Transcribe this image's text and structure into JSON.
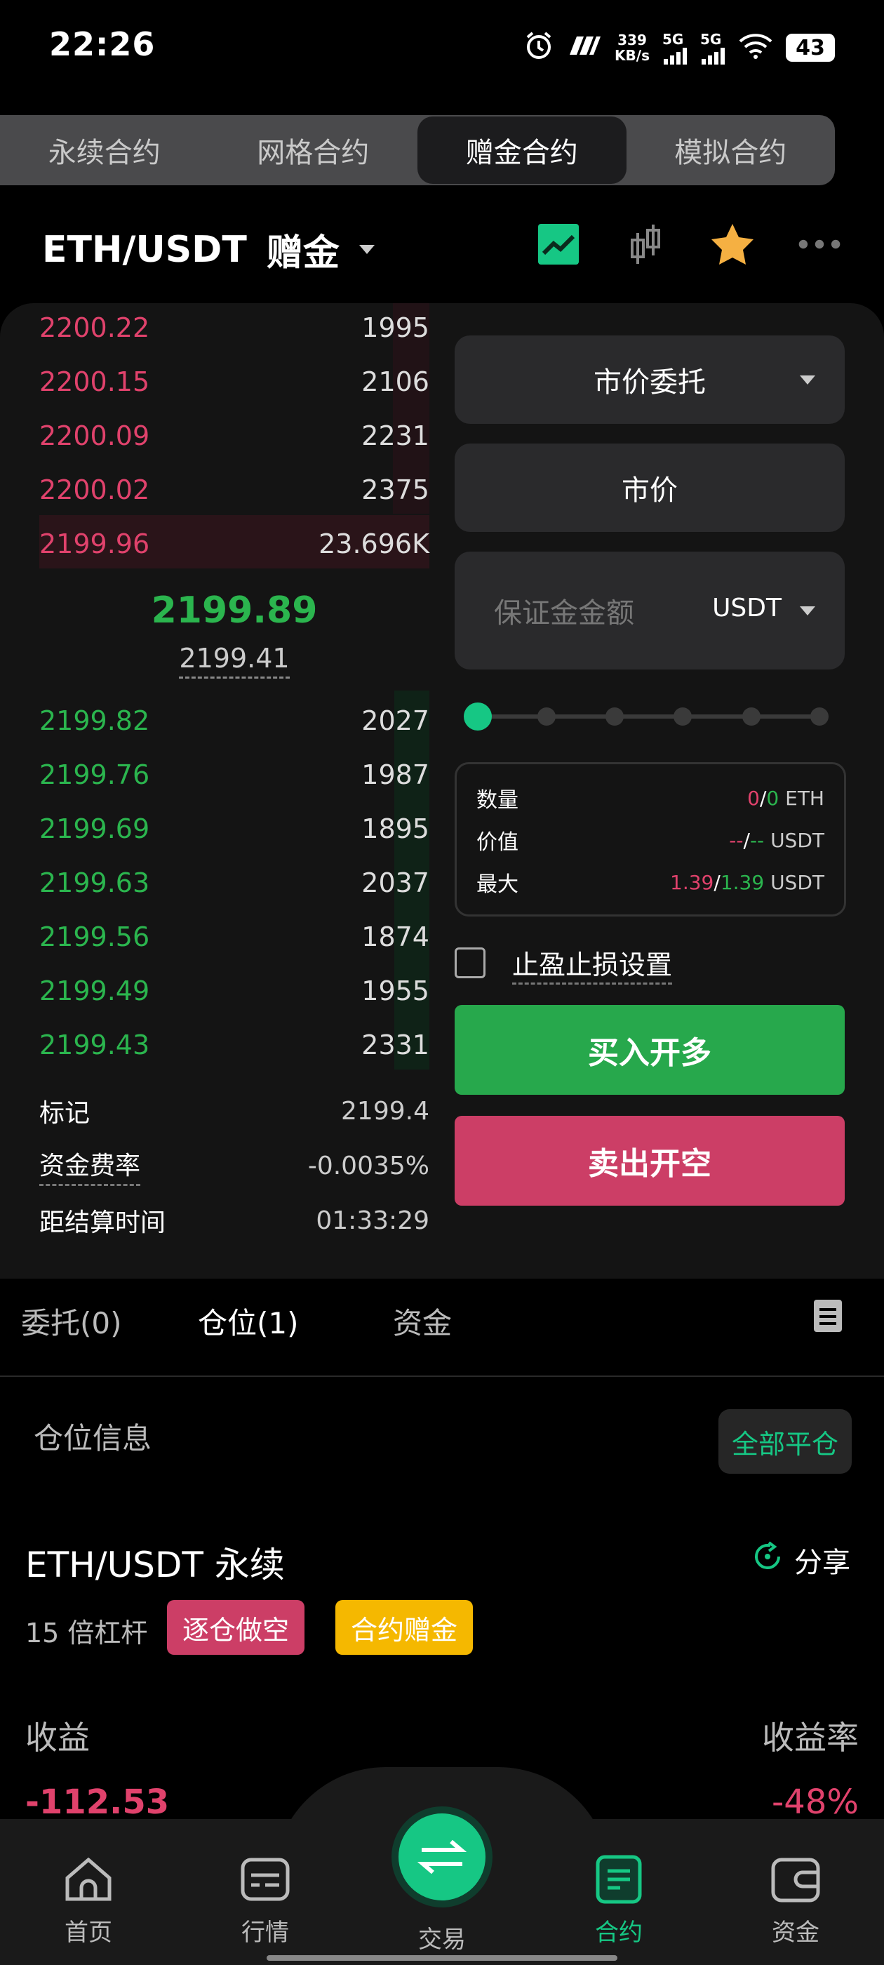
{
  "status_bar": {
    "time": "22:26",
    "net_speed": "339",
    "net_unit": "KB/s",
    "sim1": "5G",
    "sim2": "5G",
    "battery": "43"
  },
  "tabs": [
    {
      "label": "永续合约"
    },
    {
      "label": "网格合约"
    },
    {
      "label": "赠金合约"
    },
    {
      "label": "模拟合约"
    }
  ],
  "pair": {
    "symbol": "ETH/USDT",
    "tag": "赠金"
  },
  "orderbook": {
    "asks": [
      {
        "price": "2200.22",
        "qty": "1995"
      },
      {
        "price": "2200.15",
        "qty": "2106"
      },
      {
        "price": "2200.09",
        "qty": "2231"
      },
      {
        "price": "2200.02",
        "qty": "2375"
      },
      {
        "price": "2199.96",
        "qty": "23.696K"
      }
    ],
    "last_price": "2199.89",
    "mark_price": "2199.41",
    "bids": [
      {
        "price": "2199.82",
        "qty": "2027"
      },
      {
        "price": "2199.76",
        "qty": "1987"
      },
      {
        "price": "2199.69",
        "qty": "1895"
      },
      {
        "price": "2199.63",
        "qty": "2037"
      },
      {
        "price": "2199.56",
        "qty": "1874"
      },
      {
        "price": "2199.49",
        "qty": "1955"
      },
      {
        "price": "2199.43",
        "qty": "2331"
      }
    ]
  },
  "market_info": {
    "mark_label": "标记",
    "mark_value": "2199.4",
    "funding_label": "资金费率",
    "funding_value": "-0.0035%",
    "settle_label": "距结算时间",
    "settle_value": "01:33:29"
  },
  "form": {
    "order_type": "市价委托",
    "price_mode": "市价",
    "margin_placeholder": "保证金金额",
    "margin_unit": "USDT",
    "slider_percent": 0,
    "summary": {
      "qty_label": "数量",
      "qty_a": "0",
      "qty_sep": "/",
      "qty_b": "0",
      "qty_unit": "ETH",
      "value_label": "价值",
      "value_a": "--",
      "value_sep": "/",
      "value_b": "--",
      "value_unit": "USDT",
      "max_label": "最大",
      "max_a": "1.39",
      "max_sep": "/",
      "max_b": "1.39",
      "max_unit": "USDT"
    },
    "tp_sl_label": "止盈止损设置",
    "buy_label": "买入开多",
    "sell_label": "卖出开空"
  },
  "orders_tabs": {
    "orders": "委托(0)",
    "positions": "仓位(1)",
    "assets": "资金"
  },
  "position": {
    "section_title": "仓位信息",
    "close_all": "全部平仓",
    "symbol": "ETH/USDT 永续",
    "share": "分享",
    "leverage": "15 倍杠杆",
    "badge_side": "逐仓做空",
    "badge_bonus": "合约赠金",
    "pnl_label": "收益",
    "pnl_value": "-112.53",
    "roe_label": "收益率",
    "roe_value": "-48%"
  },
  "bottom_nav": [
    {
      "label": "首页"
    },
    {
      "label": "行情"
    },
    {
      "label": "交易"
    },
    {
      "label": "合约"
    },
    {
      "label": "资金"
    }
  ],
  "colors": {
    "green": "#2bb54e",
    "red": "#e0426c",
    "accent": "#16c784",
    "bonus": "#f5b800"
  }
}
